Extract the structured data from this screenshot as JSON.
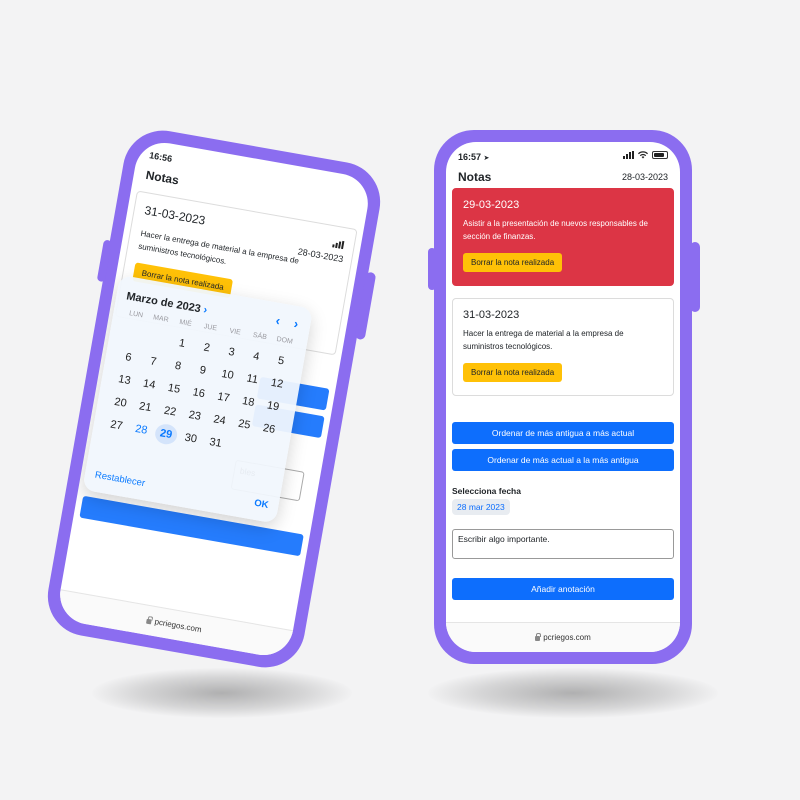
{
  "left_phone": {
    "status_time": "16:56",
    "app_title": "Notas",
    "note": {
      "date": "31-03-2023",
      "header_date": "28-03-2023",
      "text": "Hacer la entrega de material a la empresa de suministros tecnológicos.",
      "button": "Borrar la nota realizada"
    },
    "behind_input_text": "bles",
    "calendar": {
      "month_label": "Marzo de 2023",
      "weekdays": [
        "LUN",
        "MAR",
        "MIÉ",
        "JUE",
        "VIE",
        "SÁB",
        "DOM"
      ],
      "weeks": [
        [
          "",
          "",
          "1",
          "2",
          "3",
          "4",
          "5"
        ],
        [
          "6",
          "7",
          "8",
          "9",
          "10",
          "11",
          "12"
        ],
        [
          "13",
          "14",
          "15",
          "16",
          "17",
          "18",
          "19"
        ],
        [
          "20",
          "21",
          "22",
          "23",
          "24",
          "25",
          "26"
        ],
        [
          "27",
          "28",
          "29",
          "30",
          "31",
          "",
          ""
        ]
      ],
      "today": "28",
      "selected": "29",
      "reset_label": "Restablecer",
      "ok_label": "OK"
    },
    "footer_url": "pcriegos.com"
  },
  "right_phone": {
    "status_time": "16:57",
    "app_title": "Notas",
    "header_date": "28-03-2023",
    "notes": [
      {
        "date": "29-03-2023",
        "text": "Asistir a la presentación de nuevos responsables de sección de finanzas.",
        "button": "Borrar la nota realizada",
        "style": "red"
      },
      {
        "date": "31-03-2023",
        "text": "Hacer la entrega de material a la empresa de suministros tecnológicos.",
        "button": "Borrar la nota realizada",
        "style": "white"
      }
    ],
    "sort_oldest_button": "Ordenar de más antigua a más actual",
    "sort_newest_button": "Ordenar de más actual a la más antigua",
    "select_date_label": "Selecciona fecha",
    "selected_date": "28 mar 2023",
    "note_input_placeholder": "Escribir algo importante.",
    "add_button": "Añadir anotación",
    "footer_url": "pcriegos.com"
  },
  "colors": {
    "phone_frame": "#8b6df0",
    "primary_blue": "#0d6efd",
    "danger_red": "#dc3545",
    "warning_yellow": "#ffc107",
    "ios_blue": "#0a7aff"
  }
}
